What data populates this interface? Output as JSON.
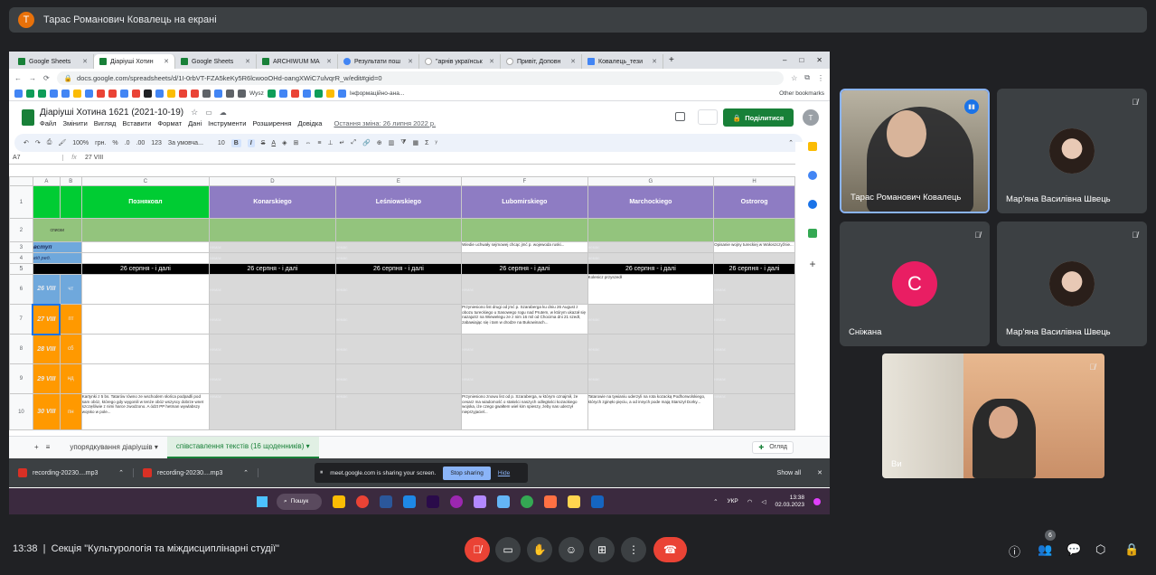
{
  "meet": {
    "presenter_initial": "Т",
    "presenter_banner": "Тарас Романович Ковалець на екрані",
    "time": "13:38",
    "meeting_title": "Секція \"Культурологія та міждисциплінарні студії\"",
    "people_count": "6"
  },
  "browser": {
    "tabs": [
      {
        "label": "Google Sheets",
        "icon": "sheets"
      },
      {
        "label": "Діаріуші Хотин",
        "icon": "sheets"
      },
      {
        "label": "Google Sheets",
        "icon": "sheets"
      },
      {
        "label": "ARCHIWUM MA",
        "icon": "sheets"
      },
      {
        "label": "Результати пош",
        "icon": "google"
      },
      {
        "label": "\"арнів українськ",
        "icon": "web"
      },
      {
        "label": "Привіт, Доповн",
        "icon": "docs"
      },
      {
        "label": "Ковалець_тези",
        "icon": "docs"
      }
    ],
    "url": "docs.google.com/spreadsheets/d/1I-0rbVT-FZA5keKy5R6lcwooOHd-oangXWiC7ulvqrR_w/edit#gid=0",
    "bookmarks": [
      "Wysz",
      "Інформаційно-ана...",
      "Other bookmarks"
    ]
  },
  "sheet": {
    "title": "Діаріуші Хотина 1621  (2021-10-19)",
    "menus": [
      "Файл",
      "Змінити",
      "Вигляд",
      "Вставити",
      "Формат",
      "Дані",
      "Інструменти",
      "Розширення",
      "Довідка"
    ],
    "last_edit": "Остання зміна: 26 липня 2022 р.",
    "share_label": "Поділитися",
    "owner_initial": "T",
    "toolbar": [
      "100%",
      "грн.",
      "%",
      ".0",
      ".00",
      "123",
      "За умовча...",
      "10"
    ],
    "namebox": "A7",
    "formula": "27 VIII",
    "columns": [
      "A",
      "B",
      "C",
      "D",
      "E",
      "F",
      "G",
      "H"
    ],
    "headers": [
      "Позняковл",
      "Konarskiego",
      "Leśniowskiego",
      "Lubomirskiego",
      "Marchockiego",
      "Ostrorog"
    ],
    "row_nums": [
      "1",
      "2",
      "3",
      "4",
      "5",
      "6",
      "7",
      "8",
      "9",
      "10"
    ],
    "row2_label": "списки",
    "row3_label": "вступ",
    "row4_label": "від ред.",
    "row5_text": "26 серпня - і далі",
    "missing": "немає",
    "date_rows": [
      {
        "date": "26 VIII",
        "day": "чт"
      },
      {
        "date": "27 VIII",
        "day": "пт"
      },
      {
        "date": "28 VIII",
        "day": "сб"
      },
      {
        "date": "29 VIII",
        "day": "нд"
      },
      {
        "date": "30 VIII",
        "day": "пн"
      }
    ],
    "f3_text": "Wiedie uchwały sejmowej chcąc jmć p. wojewoda ruski...",
    "h3_text": "Opisanie wojny tureckiej w Wołoszczyźnie...",
    "g6_text": "Kolenicz przyszedł",
    "f7_text": "Przyniesiono list drugi od jmć p. Szaraberga ku dniu 26 August z obozu tureckiego u Sasowego rogu nad Prutem, w którym ukazał się nazajutrz na Wiewelegu ze z nim 16 mil od Chocima dni 21 szedł, zabawiając się i tam w drodze na Bukowinach...",
    "c10_text": "Kartynki z 5 bs. Tatarów równo ze wschodem słońca podpadli pod sam obóz, którego gdy wygonili w tenże obóz wszyscy dobrze wnet szczęśliwie z nimi harce zwodzono. A ództ PP hetman wywlabszy wojsko w pole...",
    "f10_text": "Przyniesiono znowu list od p. Szaraberga, w którym oznajmił, że cesarz ma wiadomość o stałości naszych odległości kozackiego wojska, iże czego gwałtem wiel kim spieszy, żeby nas uderzył nieprzyjaciel...",
    "g10_text": "Tatarowie na tywianiu uderzyli na rota kozacką Podhorwolskiego, których zginęło pięciu, a od innych pode mają Starszył Dorky...",
    "tabs": [
      "упорядкування діаріушів",
      "співставлення текстів (16 щоденників)"
    ],
    "explore": "Огляд"
  },
  "downloads": [
    "recording-20230....mp3",
    "recording-20230....mp3"
  ],
  "share_notice": "meet.google.com is sharing your screen.",
  "stop_sharing": "Stop sharing",
  "hide": "Hide",
  "show_all": "Show all",
  "taskbar": {
    "search": "Пошук",
    "lang": "УКР",
    "time": "13:38",
    "date": "02.03.2023"
  },
  "participants": [
    {
      "name": "Тарас Романович Ковалець"
    },
    {
      "name": "Мар'яна Василівна Швець"
    },
    {
      "name": "Сніжана",
      "initial": "С"
    },
    {
      "name": "Мар'яна Василівна Швець"
    },
    {
      "name": "Ви"
    }
  ],
  "colors": {
    "green": "#00cc33",
    "purple": "#8e7cc3",
    "orange": "#ff9900",
    "blue": "#6fa8dc",
    "sage": "#93c47d",
    "end_call": "#ea4335"
  }
}
